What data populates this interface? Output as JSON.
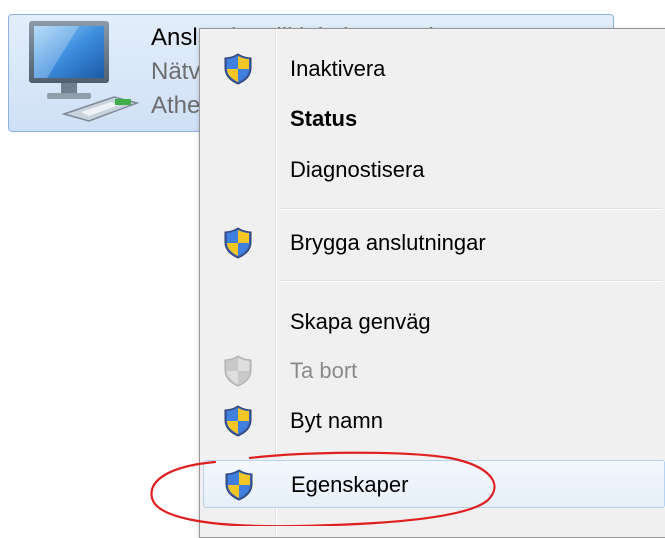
{
  "connection": {
    "name": "Anslutning till lokalt nätverk",
    "status": "Nätverk",
    "adapter": "Atheros"
  },
  "menu": {
    "items": [
      {
        "label": "Inaktivera",
        "icon": "uac-shield-icon",
        "bold": false,
        "disabled": false
      },
      {
        "label": "Status",
        "icon": "",
        "bold": true,
        "disabled": false
      },
      {
        "label": "Diagnostisera",
        "icon": "",
        "bold": false,
        "disabled": false
      },
      {
        "label": "Brygga anslutningar",
        "icon": "uac-shield-icon",
        "bold": false,
        "disabled": false
      },
      {
        "label": "Skapa genväg",
        "icon": "",
        "bold": false,
        "disabled": false
      },
      {
        "label": "Ta bort",
        "icon": "uac-shield-disabled-icon",
        "bold": false,
        "disabled": true
      },
      {
        "label": "Byt namn",
        "icon": "uac-shield-icon",
        "bold": false,
        "disabled": false
      },
      {
        "label": "Egenskaper",
        "icon": "uac-shield-icon",
        "bold": false,
        "disabled": false,
        "highlighted": true
      }
    ]
  },
  "colors": {
    "annotation": "#e02020",
    "menu_background": "#f0f0f0",
    "tile_selected": "#cfe0f6"
  }
}
